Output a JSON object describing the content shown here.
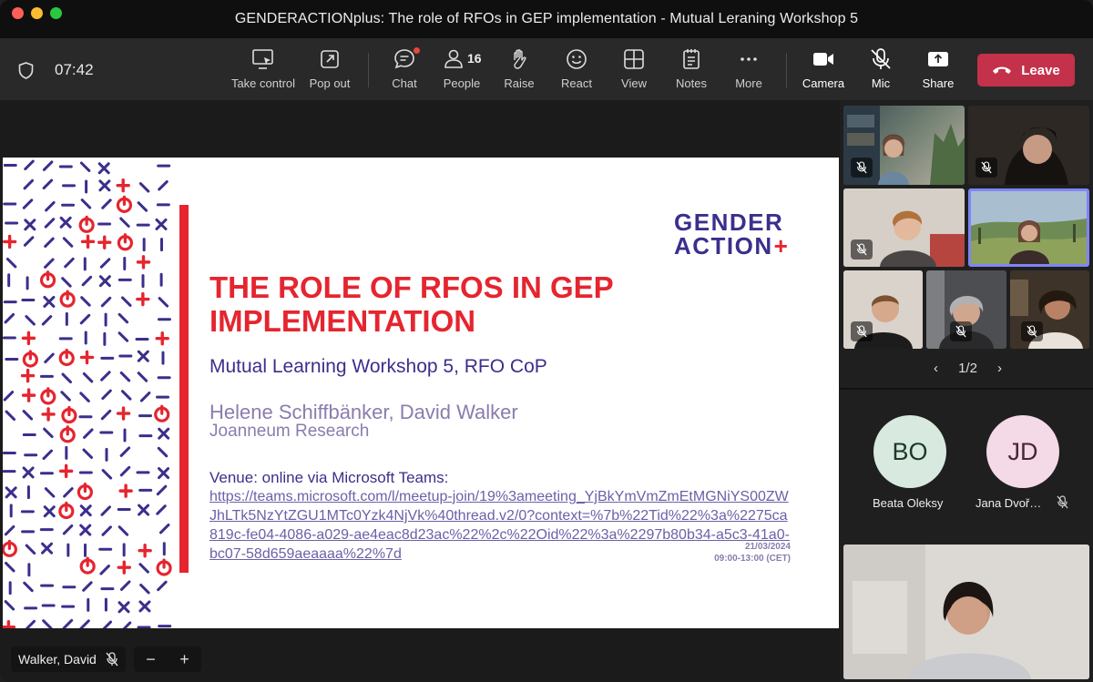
{
  "window": {
    "title": "GENDERACTIONplus: The role of RFOs in GEP implementation - Mutual Leraning Workshop 5"
  },
  "toolbar": {
    "timer": "07:42",
    "take_control": "Take control",
    "pop_out": "Pop out",
    "chat": "Chat",
    "people": "People",
    "people_count": "16",
    "raise": "Raise",
    "react": "React",
    "view": "View",
    "notes": "Notes",
    "more": "More",
    "camera": "Camera",
    "mic": "Mic",
    "share": "Share",
    "leave": "Leave"
  },
  "slide": {
    "logo_line1": "GENDER",
    "logo_line2": "ACTION",
    "logo_plus": "+",
    "title": "THE ROLE OF RFOS IN GEP IMPLEMENTATION",
    "subtitle": "Mutual Learning Workshop 5, RFO CoP",
    "authors": "Helene Schiffbänker, David Walker",
    "institution": "Joanneum Research",
    "venue": "Venue: online via Microsoft Teams:",
    "link": "https://teams.microsoft.com/l/meetup-join/19%3ameeting_YjBkYmVmZmEtMGNiYS00ZWJhLTk5NzYtZGU1MTc0Yzk4NjVk%40thread.v2/0?context=%7b%22Tid%22%3a%2275ca819c-fe04-4086-a029-ae4eac8d23ac%22%2c%22Oid%22%3a%2297b80b34-a5c3-41a0-bc07-58d659aeaaaa%22%7d",
    "date": "21/03/2024",
    "time": "09:00-13:00 (CET)"
  },
  "presenter": {
    "name": "Walker, David",
    "zoom_out": "−",
    "zoom_in": "+"
  },
  "gallery": {
    "pager": "1/2"
  },
  "attendees": [
    {
      "initials": "BO",
      "name": "Beata Oleksy",
      "bg": "#d8eadf",
      "fg": "#1d3a26"
    },
    {
      "initials": "JD",
      "name": "Jana Dvoř…",
      "bg": "#f4d9e6",
      "fg": "#4a2438"
    }
  ],
  "colors": {
    "leave": "#c4314b",
    "slide_red": "#e5252f",
    "slide_purple": "#3a2f8c"
  }
}
